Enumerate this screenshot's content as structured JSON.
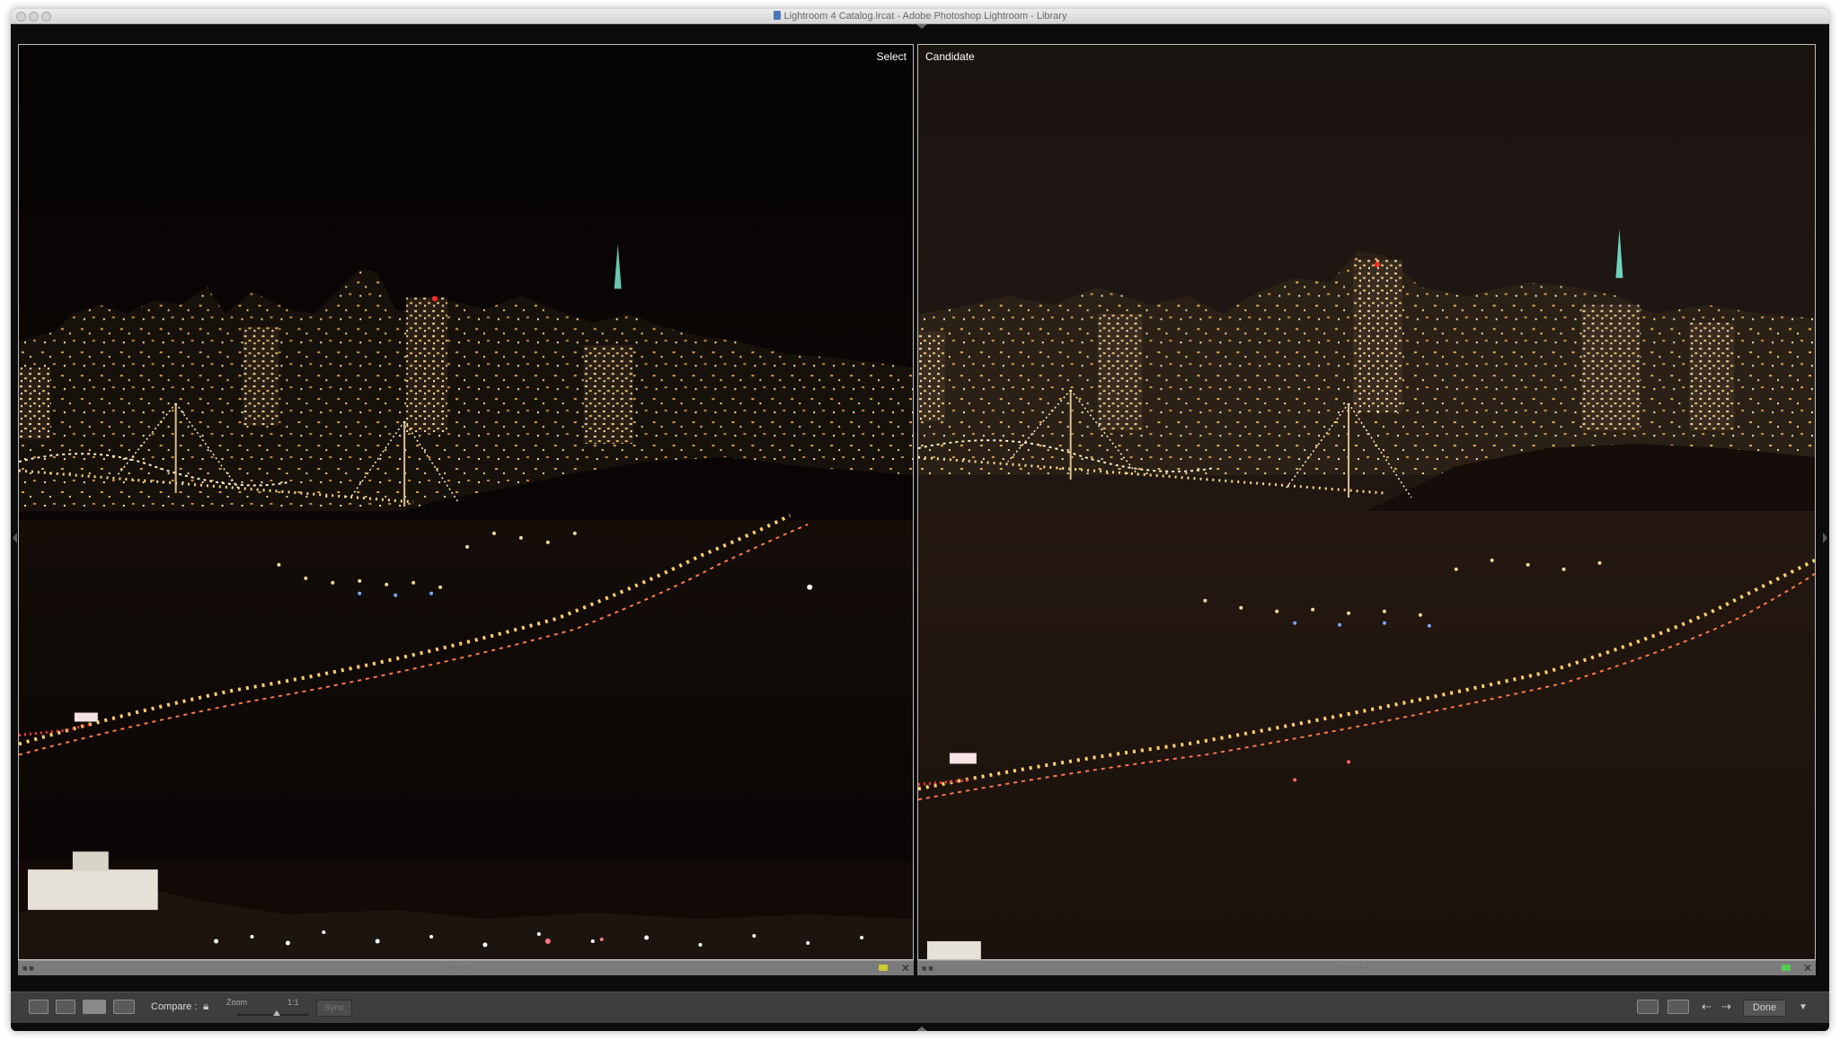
{
  "window": {
    "title": "Lightroom 4 Catalog.lrcat - Adobe Photoshop Lightroom - Library"
  },
  "compare": {
    "select_label": "Select",
    "candidate_label": "Candidate"
  },
  "toolbar": {
    "compare_label": "Compare :",
    "zoom_label": "Zoom",
    "zoom_value": "1:1",
    "sync_label": "Sync",
    "done_label": "Done"
  },
  "icons": {
    "grid_view": "grid-icon",
    "loupe_view": "loupe-icon",
    "compare_view": "compare-icon",
    "survey_view": "survey-icon",
    "lock": "lock-icon",
    "swap": "swap-icon",
    "make_select": "make-select-icon",
    "previous": "arrow-left-icon",
    "next": "arrow-right-icon",
    "menu": "chevron-down-icon",
    "close": "close-icon",
    "flag": "flag-icon"
  },
  "colors": {
    "select_color_label": "#cccc33",
    "candidate_color_label": "#55cc55",
    "panel_bg": "#3e3e3e",
    "photo_sky": "#060404"
  }
}
